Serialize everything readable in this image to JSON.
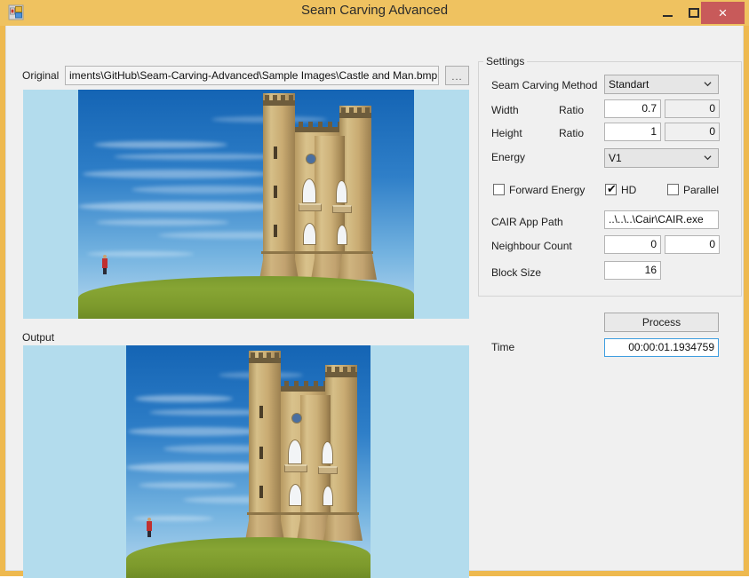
{
  "window": {
    "title": "Seam Carving Advanced",
    "icon": "application-icon",
    "controls": {
      "minimize": "–",
      "maximize": "□",
      "close": "×"
    }
  },
  "left_panel": {
    "original_label": "Original",
    "original_path": "iments\\GitHub\\Seam-Carving-Advanced\\Sample Images\\Castle and Man.bmp",
    "browse_label": "...",
    "output_label": "Output"
  },
  "settings": {
    "legend": "Settings",
    "seam_carving_method_label": "Seam Carving Method",
    "seam_carving_method_value": "Standart",
    "width_label": "Width",
    "width_ratio_label": "Ratio",
    "width_ratio_value": "0.7",
    "width_pixels_value": "0",
    "height_label": "Height",
    "height_ratio_label": "Ratio",
    "height_ratio_value": "1",
    "height_pixels_value": "0",
    "energy_label": "Energy",
    "energy_value": "V1",
    "forward_energy_label": "Forward Energy",
    "forward_energy_checked": "",
    "hd_label": "HD",
    "hd_checked": "✔",
    "parallel_label": "Parallel",
    "parallel_checked": "",
    "cair_app_path_label": "CAIR App Path",
    "cair_app_path_value": "..\\..\\..\\Cair\\CAIR.exe",
    "neighbour_count_label": "Neighbour Count",
    "neighbour_count_value": "0",
    "neighbour_count_value2": "0",
    "block_size_label": "Block Size",
    "block_size_value": "16"
  },
  "actions": {
    "process_label": "Process",
    "time_label": "Time",
    "time_value": "00:00:01.1934759"
  },
  "colors": {
    "title_bar": "#efc260",
    "window_border": "#eeb94f",
    "close_button": "#c85a5a",
    "client_background": "#f0f0f0",
    "picture_box_background": "#b3dced",
    "focus_border": "#3f9ee0"
  }
}
